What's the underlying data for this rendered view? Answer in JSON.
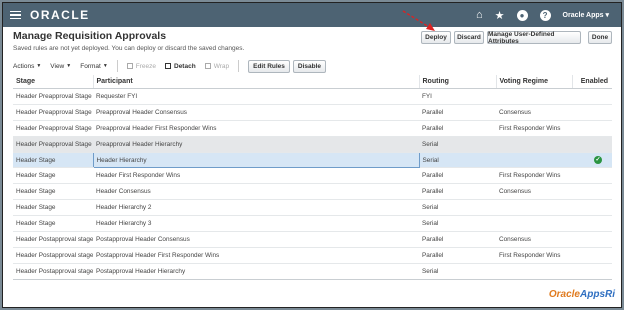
{
  "header": {
    "logo": "ORACLE",
    "apps_label": "Oracle Apps",
    "icons": [
      "home-icon",
      "star-icon",
      "notifications-icon",
      "help-icon"
    ],
    "bar_color": "#4d6373"
  },
  "page": {
    "title": "Manage Requisition Approvals",
    "subtitle": "Saved rules are not yet deployed. You can deploy or discard the saved changes."
  },
  "buttons": {
    "deploy": "Deploy",
    "discard": "Discard",
    "manage_udf": "Manage User-Defined Attributes",
    "done": "Done"
  },
  "toolbar": {
    "actions": "Actions",
    "view": "View",
    "format": "Format",
    "freeze": "Freeze",
    "detach": "Detach",
    "wrap": "Wrap",
    "edit_rules": "Edit Rules",
    "disable": "Disable"
  },
  "table": {
    "columns": [
      "Stage",
      "Participant",
      "Routing",
      "Voting Regime",
      "Enabled"
    ],
    "rows": [
      {
        "stage": "Header Preapproval Stage",
        "participant": "Requester FYI",
        "routing": "FYI",
        "voting": "",
        "enabled": false
      },
      {
        "stage": "Header Preapproval Stage",
        "participant": "Preapproval Header Consensus",
        "routing": "Parallel",
        "voting": "Consensus",
        "enabled": false
      },
      {
        "stage": "Header Preapproval Stage",
        "participant": "Preapproval Header First Responder Wins",
        "routing": "Parallel",
        "voting": "First Responder Wins",
        "enabled": false
      },
      {
        "stage": "Header Preapproval Stage",
        "participant": "Preapproval Header Hierarchy",
        "routing": "Serial",
        "voting": "",
        "enabled": false
      },
      {
        "stage": "Header Stage",
        "participant": "Header Hierarchy",
        "routing": "Serial",
        "voting": "",
        "enabled": true
      },
      {
        "stage": "Header Stage",
        "participant": "Header First Responder Wins",
        "routing": "Parallel",
        "voting": "First Responder Wins",
        "enabled": false
      },
      {
        "stage": "Header Stage",
        "participant": "Header Consensus",
        "routing": "Parallel",
        "voting": "Consensus",
        "enabled": false
      },
      {
        "stage": "Header Stage",
        "participant": "Header Hierarchy 2",
        "routing": "Serial",
        "voting": "",
        "enabled": false
      },
      {
        "stage": "Header Stage",
        "participant": "Header Hierarchy 3",
        "routing": "Serial",
        "voting": "",
        "enabled": false
      },
      {
        "stage": "Header Postapproval stage",
        "participant": "Postapproval Header Consensus",
        "routing": "Parallel",
        "voting": "Consensus",
        "enabled": false
      },
      {
        "stage": "Header Postapproval stage",
        "participant": "Postapproval Header First Responder Wins",
        "routing": "Parallel",
        "voting": "First Responder Wins",
        "enabled": false
      },
      {
        "stage": "Header Postapproval stage",
        "participant": "Postapproval Header Hierarchy",
        "routing": "Serial",
        "voting": "",
        "enabled": false
      }
    ],
    "highlighted_row": 3,
    "selected_row": 4
  },
  "watermark": {
    "prefix": "Oracle",
    "suffix": "AppsRi"
  }
}
